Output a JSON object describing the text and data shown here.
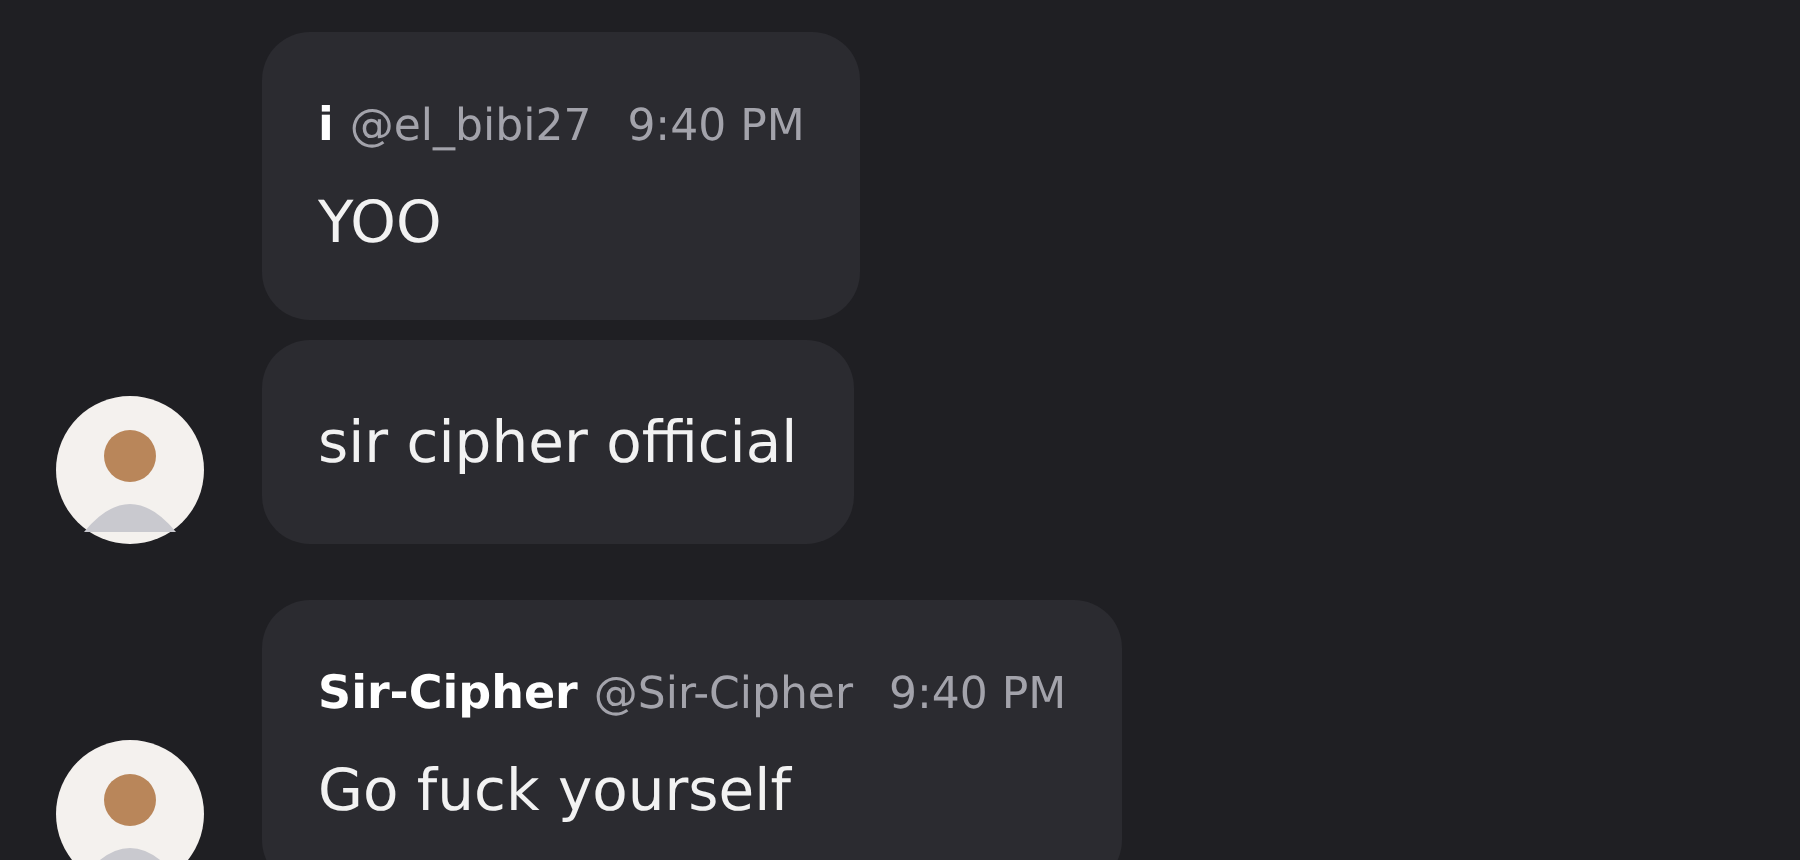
{
  "messages": [
    {
      "kind": "with_header",
      "avatar": false,
      "display_name": "i",
      "username": "@el_bibi27",
      "time": "9:40 PM",
      "text": "YOO"
    },
    {
      "kind": "text_only",
      "avatar": true,
      "text": "sir cipher official"
    },
    {
      "kind": "with_header",
      "avatar": true,
      "display_name": "Sir-Cipher",
      "username": "@Sir-Cipher",
      "time": "9:40 PM",
      "text": "Go fuck yourself"
    }
  ]
}
